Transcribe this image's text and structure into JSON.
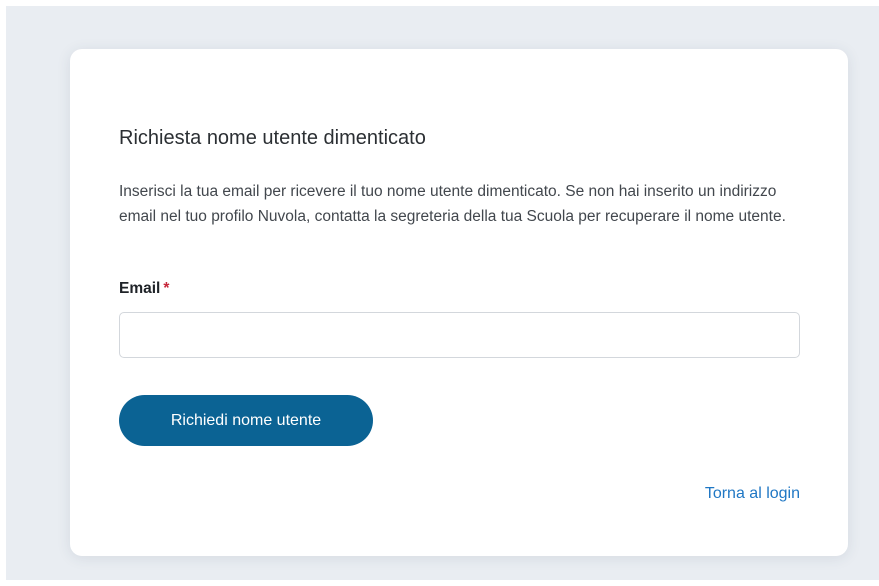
{
  "form": {
    "title": "Richiesta nome utente dimenticato",
    "description": "Inserisci la tua email per ricevere il tuo nome utente dimenticato. Se non hai inserito un indirizzo email nel tuo profilo Nuvola, contatta la segreteria della tua Scuola per recuperare il nome utente.",
    "email_label": "Email",
    "required_mark": "*",
    "email_value": "",
    "email_placeholder": "",
    "submit_label": "Richiedi nome utente",
    "back_link_label": "Torna al login"
  },
  "colors": {
    "primary_button": "#0b6394",
    "link": "#1f77c4",
    "required": "#c6273a",
    "page_background": "#e9edf2"
  }
}
